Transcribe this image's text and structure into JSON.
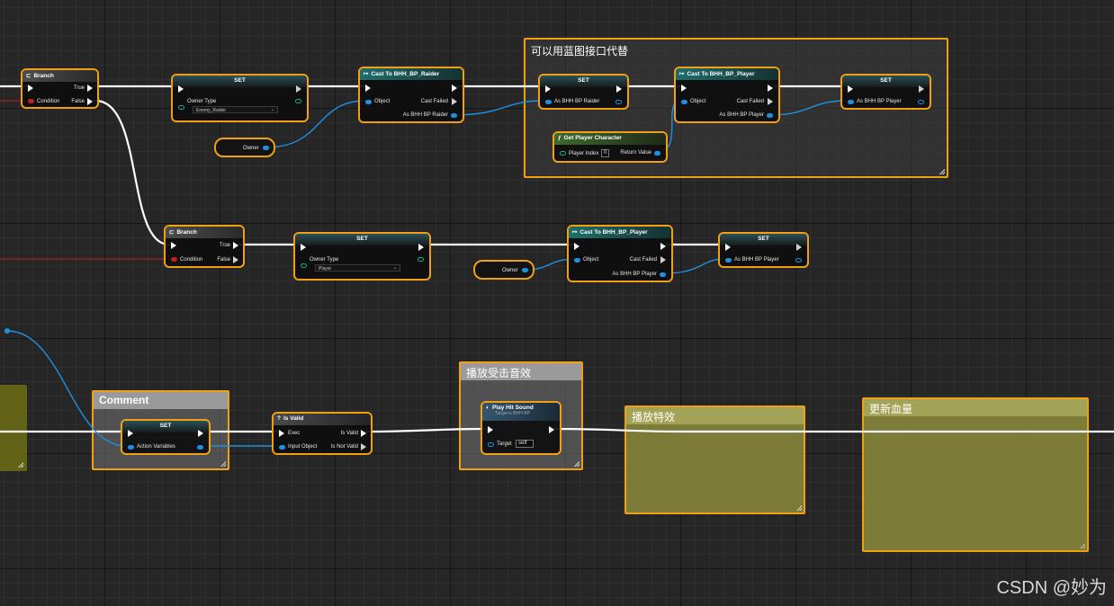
{
  "comments": {
    "top_group": "可以用蓝图接口代替",
    "comment_generic": "Comment",
    "play_sound": "播放受击音效",
    "play_effect": "播放特效",
    "update_health": "更新血量"
  },
  "nodes": {
    "branch1": {
      "title": "Branch",
      "true": "True",
      "false": "False",
      "condition": "Condition"
    },
    "set1": {
      "title": "SET",
      "owner_type": "Owner Type",
      "value": "Enemy_Raider"
    },
    "owner1": "Owner",
    "cast1": {
      "title": "Cast To BHH_BP_Raider",
      "object": "Object",
      "failed": "Cast Failed",
      "as": "As BHH BP Raider"
    },
    "set2": {
      "title": "SET",
      "as": "As BHH BP Raider"
    },
    "cast2": {
      "title": "Cast To BHH_BP_Player",
      "object": "Object",
      "failed": "Cast Failed",
      "as": "As BHH BP Player"
    },
    "set3": {
      "title": "SET",
      "as": "As BHH BP Player"
    },
    "getpc": {
      "title": "Get Player Character",
      "index": "Player Index",
      "index_value": "0",
      "ret": "Return Value"
    },
    "branch2": {
      "title": "Branch",
      "true": "True",
      "false": "False",
      "condition": "Condition"
    },
    "set4": {
      "title": "SET",
      "owner_type": "Owner Type",
      "value": "Player"
    },
    "owner2": "Owner",
    "cast3": {
      "title": "Cast To BHH_BP_Player",
      "object": "Object",
      "failed": "Cast Failed",
      "as": "As BHH BP Player"
    },
    "set5": {
      "title": "SET",
      "as": "As BHH BP Player"
    },
    "set6": {
      "title": "SET",
      "action_vars": "Action Variables"
    },
    "isvalid": {
      "title": "Is Valid",
      "exec": "Exec",
      "is_valid": "Is Valid",
      "input": "Input Object",
      "not_valid": "Is Not Valid"
    },
    "playhit": {
      "title": "Play Hit Sound",
      "sub": "Target is BHH BP",
      "target": "Target",
      "self": "self"
    }
  },
  "watermark": "CSDN @妙为",
  "icons": [
    "branch-icon",
    "cast-icon",
    "function-icon",
    "isvalid-icon",
    "playsound-icon",
    "exec-pin-icon",
    "data-pin-icon",
    "dropdown-arrow-icon",
    "resize-grip-icon"
  ],
  "colors": {
    "background": "#262626",
    "selection": "#f0a014",
    "exec_wire": "#ffffff",
    "object_wire": "#1f8fe0",
    "bool_wire": "#c31e1e",
    "cast_header": "#1f6f6c",
    "function_header": "#3f6a2e",
    "comment_olive": "#8c8c3c",
    "comment_gray": "#9a9a9a"
  }
}
